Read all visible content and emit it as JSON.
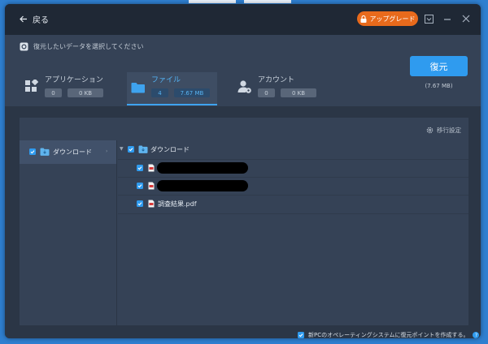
{
  "header": {
    "back_label": "戻る",
    "upgrade_label": "アップグレード"
  },
  "hint": {
    "text": "復元したいデータを選択してください"
  },
  "categories": [
    {
      "label": "アプリケーション",
      "count": "0",
      "size": "0 KB"
    },
    {
      "label": "ファイル",
      "count": "4",
      "size": "7.67 MB"
    },
    {
      "label": "アカウント",
      "count": "0",
      "size": "0 KB"
    }
  ],
  "restore": {
    "label": "復元",
    "size": "(7.67 MB)"
  },
  "migration_settings": {
    "label": "移行設定"
  },
  "sidebar": {
    "folder_label": "ダウンロード"
  },
  "tree": {
    "root_label": "ダウンロード",
    "files": [
      {
        "name": "",
        "redacted": true
      },
      {
        "name": "",
        "redacted": true
      },
      {
        "name": "調査結果.pdf",
        "redacted": false
      }
    ]
  },
  "footer": {
    "restore_point_label": "新PCのオペレーティングシステムに復元ポイントを作成する。",
    "help": "?"
  },
  "colors": {
    "accent": "#2f9bef",
    "upgrade": "#e86a1c",
    "window_bg": "#2b3646",
    "panel_bg": "#354256"
  }
}
